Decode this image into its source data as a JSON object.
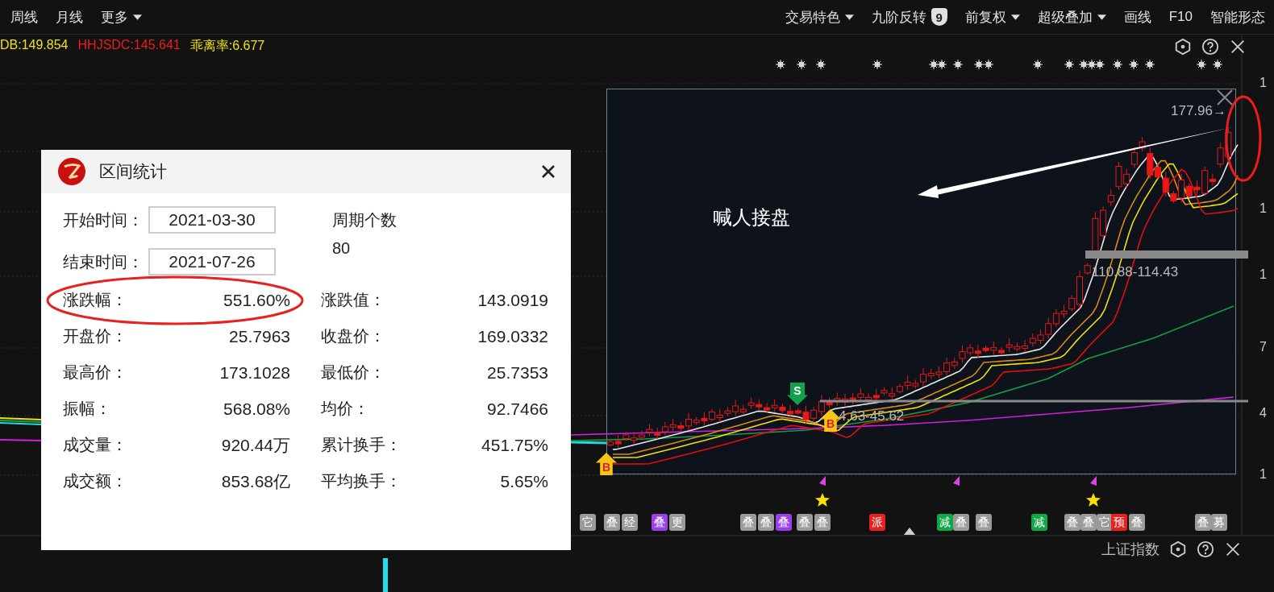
{
  "toolbar": {
    "left": [
      {
        "label": "周线",
        "kind": "text"
      },
      {
        "label": "月线",
        "kind": "text"
      },
      {
        "label": "更多",
        "kind": "dropdown"
      }
    ],
    "right": [
      {
        "label": "交易特色",
        "kind": "dropdown"
      },
      {
        "label": "九阶反转",
        "kind": "badge",
        "badge": "9"
      },
      {
        "label": "前复权",
        "kind": "dropdown"
      },
      {
        "label": "超级叠加",
        "kind": "dropdown"
      },
      {
        "label": "画线",
        "kind": "text"
      },
      {
        "label": "F10",
        "kind": "text"
      },
      {
        "label": "智能形态",
        "kind": "text"
      }
    ]
  },
  "indicators": [
    {
      "text": "DB:149.854",
      "color": "#f0e010"
    },
    {
      "text": "HHJSDC:145.641",
      "color": "#f01c1c"
    },
    {
      "text": "乖离率:6.677",
      "color": "#f0e010"
    }
  ],
  "chart": {
    "axis_labels": [
      "1",
      "1",
      "1",
      "7",
      "4",
      "1"
    ],
    "peak_label": "177.96→",
    "note": "喊人接盘",
    "zone_labels": [
      "110.88-114.43",
      "4.63-45.62"
    ],
    "signals": [
      {
        "kind": "buy",
        "text": "B"
      },
      {
        "kind": "sell",
        "text": "S"
      },
      {
        "kind": "buy",
        "text": "B"
      }
    ],
    "tags": [
      {
        "text": "它",
        "color": "#9a9a9a"
      },
      {
        "text": "叠",
        "color": "#9a9a9a"
      },
      {
        "text": "经",
        "color": "#9a9a9a"
      },
      {
        "text": "叠",
        "color": "#9b3fe8"
      },
      {
        "text": "更",
        "color": "#9a9a9a"
      },
      {
        "text": "叠",
        "color": "#9a9a9a"
      },
      {
        "text": "叠",
        "color": "#9a9a9a"
      },
      {
        "text": "叠",
        "color": "#9b3fe8"
      },
      {
        "text": "叠",
        "color": "#9a9a9a"
      },
      {
        "text": "叠",
        "color": "#9a9a9a"
      },
      {
        "text": "派",
        "color": "#e82020"
      },
      {
        "text": "减",
        "color": "#10a844"
      },
      {
        "text": "叠",
        "color": "#9a9a9a"
      },
      {
        "text": "叠",
        "color": "#9a9a9a"
      },
      {
        "text": "减",
        "color": "#10a844"
      },
      {
        "text": "叠",
        "color": "#9a9a9a"
      },
      {
        "text": "叠",
        "color": "#9a9a9a"
      },
      {
        "text": "它",
        "color": "#9a9a9a"
      },
      {
        "text": "预",
        "color": "#e82020"
      },
      {
        "text": "叠",
        "color": "#9a9a9a"
      },
      {
        "text": "叠",
        "color": "#9a9a9a"
      },
      {
        "text": "募",
        "color": "#9a9a9a"
      }
    ]
  },
  "bottom_panel": {
    "title": "上证指数"
  },
  "dialog": {
    "title": "区间统计",
    "start_label": "开始时间：",
    "start": "2021-03-30",
    "end_label": "结束时间：",
    "end": "2021-07-26",
    "period_label": "周期个数",
    "period": "80",
    "stats": [
      {
        "label": "涨跌幅：",
        "value": "551.60%",
        "highlighted": true
      },
      {
        "label": "涨跌值：",
        "value": "143.0919",
        "highlighted": false
      },
      {
        "label": "开盘价：",
        "value": "25.7963",
        "highlighted": false
      },
      {
        "label": "收盘价：",
        "value": "169.0332",
        "highlighted": false
      },
      {
        "label": "最高价：",
        "value": "173.1028",
        "highlighted": false
      },
      {
        "label": "最低价：",
        "value": "25.7353",
        "highlighted": false
      },
      {
        "label": "振幅：",
        "value": "568.08%",
        "highlighted": false
      },
      {
        "label": "均价：",
        "value": "92.7466",
        "highlighted": false
      },
      {
        "label": "成交量：",
        "value": "920.44万",
        "highlighted": false
      },
      {
        "label": "累计换手：",
        "value": "451.75%",
        "highlighted": false
      },
      {
        "label": "成交额：",
        "value": "853.68亿",
        "highlighted": false
      },
      {
        "label": "平均换手：",
        "value": "5.65%",
        "highlighted": false
      }
    ]
  }
}
